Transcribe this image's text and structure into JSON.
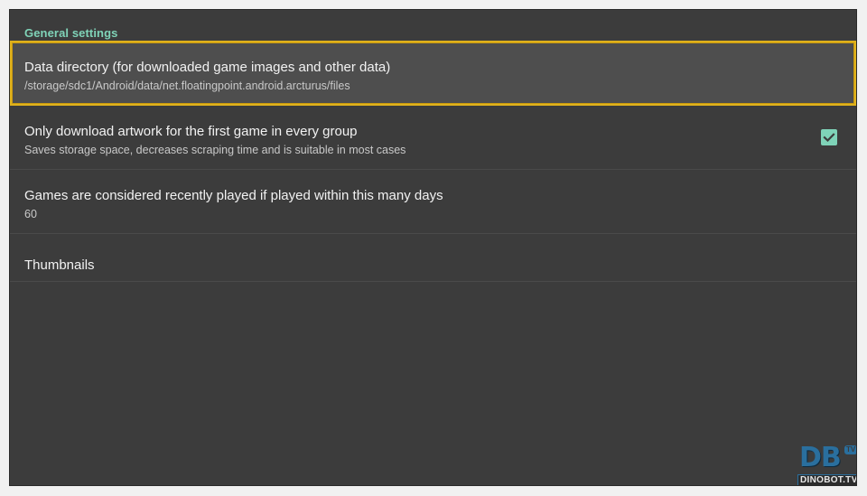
{
  "section": {
    "header": "General settings"
  },
  "settings": [
    {
      "title": "Data directory (for downloaded game images and other data)",
      "subtitle": "/storage/sdc1/Android/data/net.floatingpoint.android.arcturus/files",
      "focused": true
    },
    {
      "title": "Only download artwork for the first game in every group",
      "subtitle": "Saves storage space, decreases scraping time and is suitable in most cases",
      "checked": true
    },
    {
      "title": "Games are considered recently played if played within this many days",
      "subtitle": "60"
    },
    {
      "title": "Thumbnails"
    }
  ],
  "watermark": {
    "logo": "DB",
    "badge": "TV",
    "site": "DINOBOT.TV"
  },
  "colors": {
    "accent": "#7fd3b8",
    "focus_border": "#e0b21c",
    "background": "#3c3c3c"
  },
  "icons": {
    "checkbox": "check-icon"
  }
}
